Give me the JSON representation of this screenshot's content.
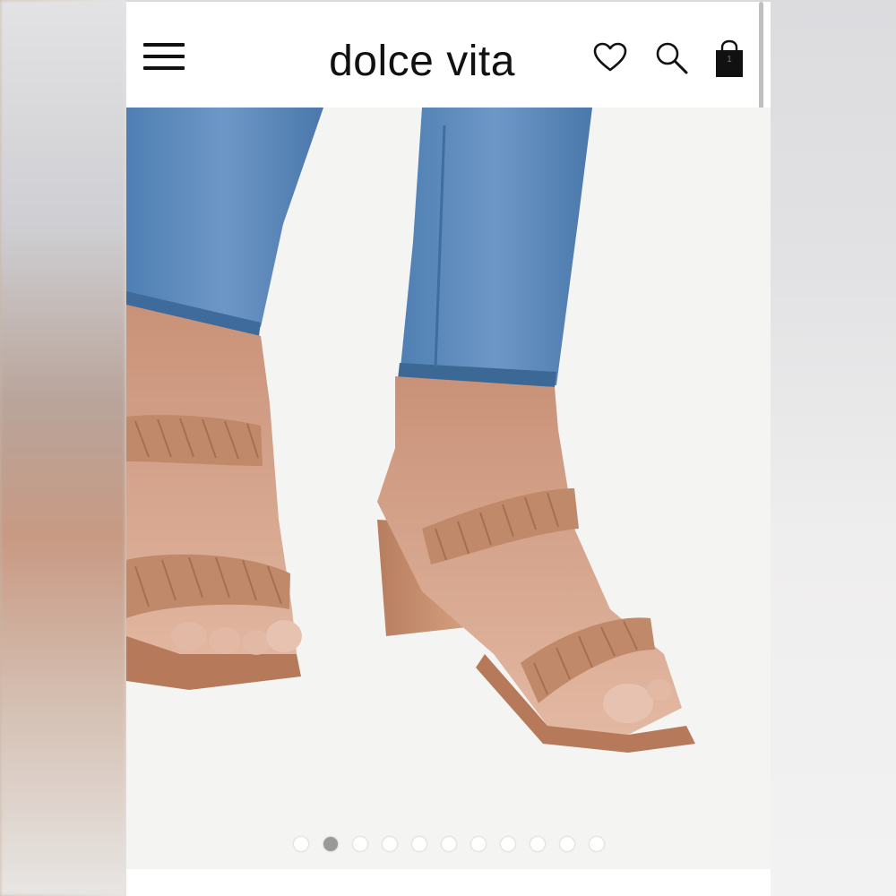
{
  "header": {
    "brand": "dolce vita",
    "menu_icon": "hamburger-menu-icon",
    "wishlist_icon": "heart-icon",
    "search_icon": "search-icon",
    "bag_icon": "shopping-bag-icon",
    "bag_count": "1"
  },
  "product_image": {
    "description_icon": "product-photo"
  },
  "carousel": {
    "total": 11,
    "active_index": 1,
    "active_color": "#999999",
    "inactive_color": "#ffffff"
  },
  "colors": {
    "accent": "#111111",
    "sandal": "#c08a6a",
    "denim": "#5a86b6"
  }
}
